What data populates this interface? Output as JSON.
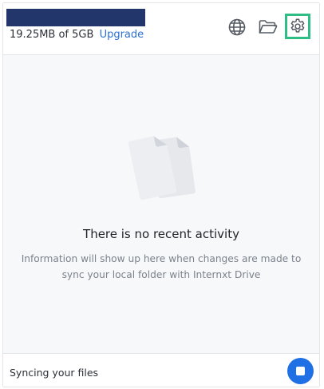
{
  "header": {
    "usage_text": "19.25MB of 5GB",
    "upgrade_label": "Upgrade",
    "icons": {
      "globe": "globe-icon",
      "folder": "folder-open-icon",
      "settings": "gear-icon"
    }
  },
  "main": {
    "empty_title": "There is no recent activity",
    "empty_description": "Information will show up here when changes are made to sync your local folder with Internxt Drive"
  },
  "footer": {
    "status_text": "Syncing your files",
    "stop_icon": "stop-icon"
  },
  "colors": {
    "accent": "#1f6fe5",
    "upgrade_link": "#2b6fd6",
    "highlight": "#2fbd86",
    "redaction": "#23366b",
    "background": "#f7f8fa"
  }
}
